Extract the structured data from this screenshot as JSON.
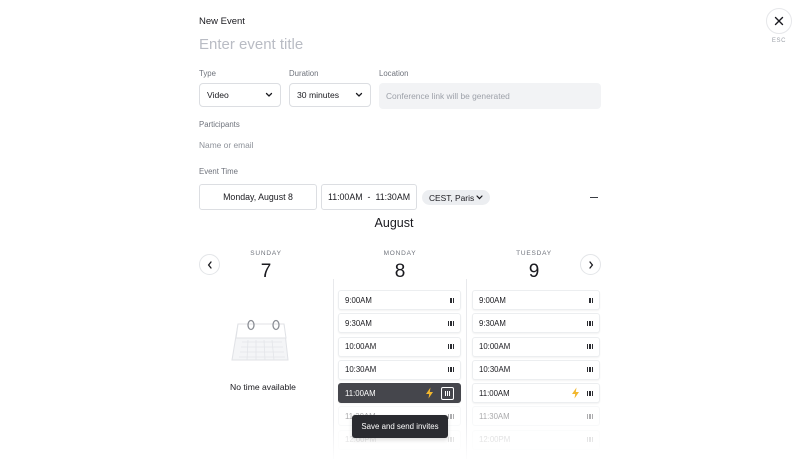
{
  "header": {
    "title": "New Event",
    "event_title_placeholder": "Enter event title",
    "close_hint": "ESC"
  },
  "form": {
    "type": {
      "label": "Type",
      "value": "Video"
    },
    "duration": {
      "label": "Duration",
      "value": "30 minutes"
    },
    "location": {
      "label": "Location",
      "placeholder": "Conference link will be generated"
    },
    "participants": {
      "label": "Participants",
      "placeholder": "Name or email"
    },
    "event_time": {
      "label": "Event Time",
      "date": "Monday, August 8",
      "start": "11:00AM",
      "separator": "-",
      "end": "11:30AM",
      "timezone": "CEST, Paris"
    }
  },
  "calendar": {
    "month": "August",
    "days": [
      {
        "name": "SUNDAY",
        "number": "7",
        "empty_text": "No time available"
      },
      {
        "name": "MONDAY",
        "number": "8",
        "slots": [
          {
            "time": "9:00AM",
            "availability": 2
          },
          {
            "time": "9:30AM",
            "availability": 3
          },
          {
            "time": "10:00AM",
            "availability": 3
          },
          {
            "time": "10:30AM",
            "availability": 3
          },
          {
            "time": "11:00AM",
            "availability": 3,
            "selected": true,
            "suggested": true
          },
          {
            "time": "11:30AM",
            "availability": 3
          },
          {
            "time": "12:00PM",
            "availability": 3
          }
        ]
      },
      {
        "name": "TUESDAY",
        "number": "9",
        "slots": [
          {
            "time": "9:00AM",
            "availability": 2
          },
          {
            "time": "9:30AM",
            "availability": 3
          },
          {
            "time": "10:00AM",
            "availability": 3
          },
          {
            "time": "10:30AM",
            "availability": 3
          },
          {
            "time": "11:00AM",
            "availability": 3,
            "suggested": true
          },
          {
            "time": "11:30AM",
            "availability": 3
          },
          {
            "time": "12:00PM",
            "availability": 3
          }
        ]
      }
    ]
  },
  "actions": {
    "save_label": "Save and send invites"
  },
  "colors": {
    "accent_bolt": "#f2b72e",
    "selected_slot": "#45464c",
    "primary_button": "#2a2b30"
  }
}
